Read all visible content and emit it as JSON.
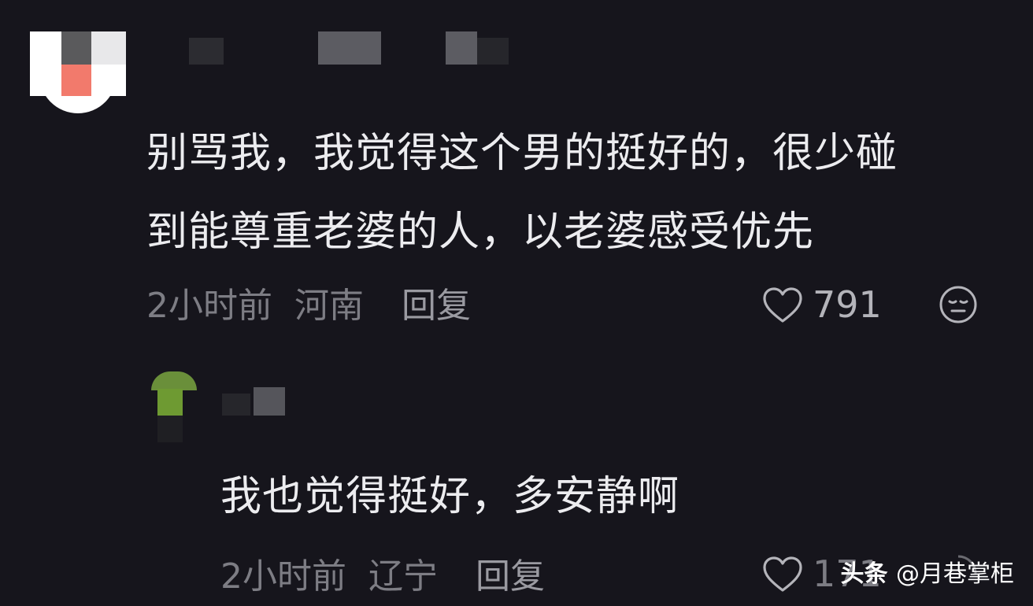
{
  "comments": [
    {
      "text_line1": "别骂我，我觉得这个男的挺好的，很少碰",
      "text_line2": "到能尊重老婆的人，以老婆感受优先",
      "time": "2小时前",
      "location": "河南",
      "reply_label": "回复",
      "likes": "791",
      "like_icon": "heart-outline-icon",
      "emoji_icon": "sleepy-face-icon"
    },
    {
      "text_line1": "我也觉得挺好，多安静啊",
      "time": "2小时前",
      "location": "辽宁",
      "reply_label": "回复",
      "likes": "171",
      "like_icon": "heart-outline-icon"
    }
  ],
  "watermark": {
    "brand": "头条",
    "account": "@月巷掌柜"
  },
  "colors": {
    "background": "#16151c",
    "text": "#ececef",
    "meta": "#7d7d84"
  }
}
